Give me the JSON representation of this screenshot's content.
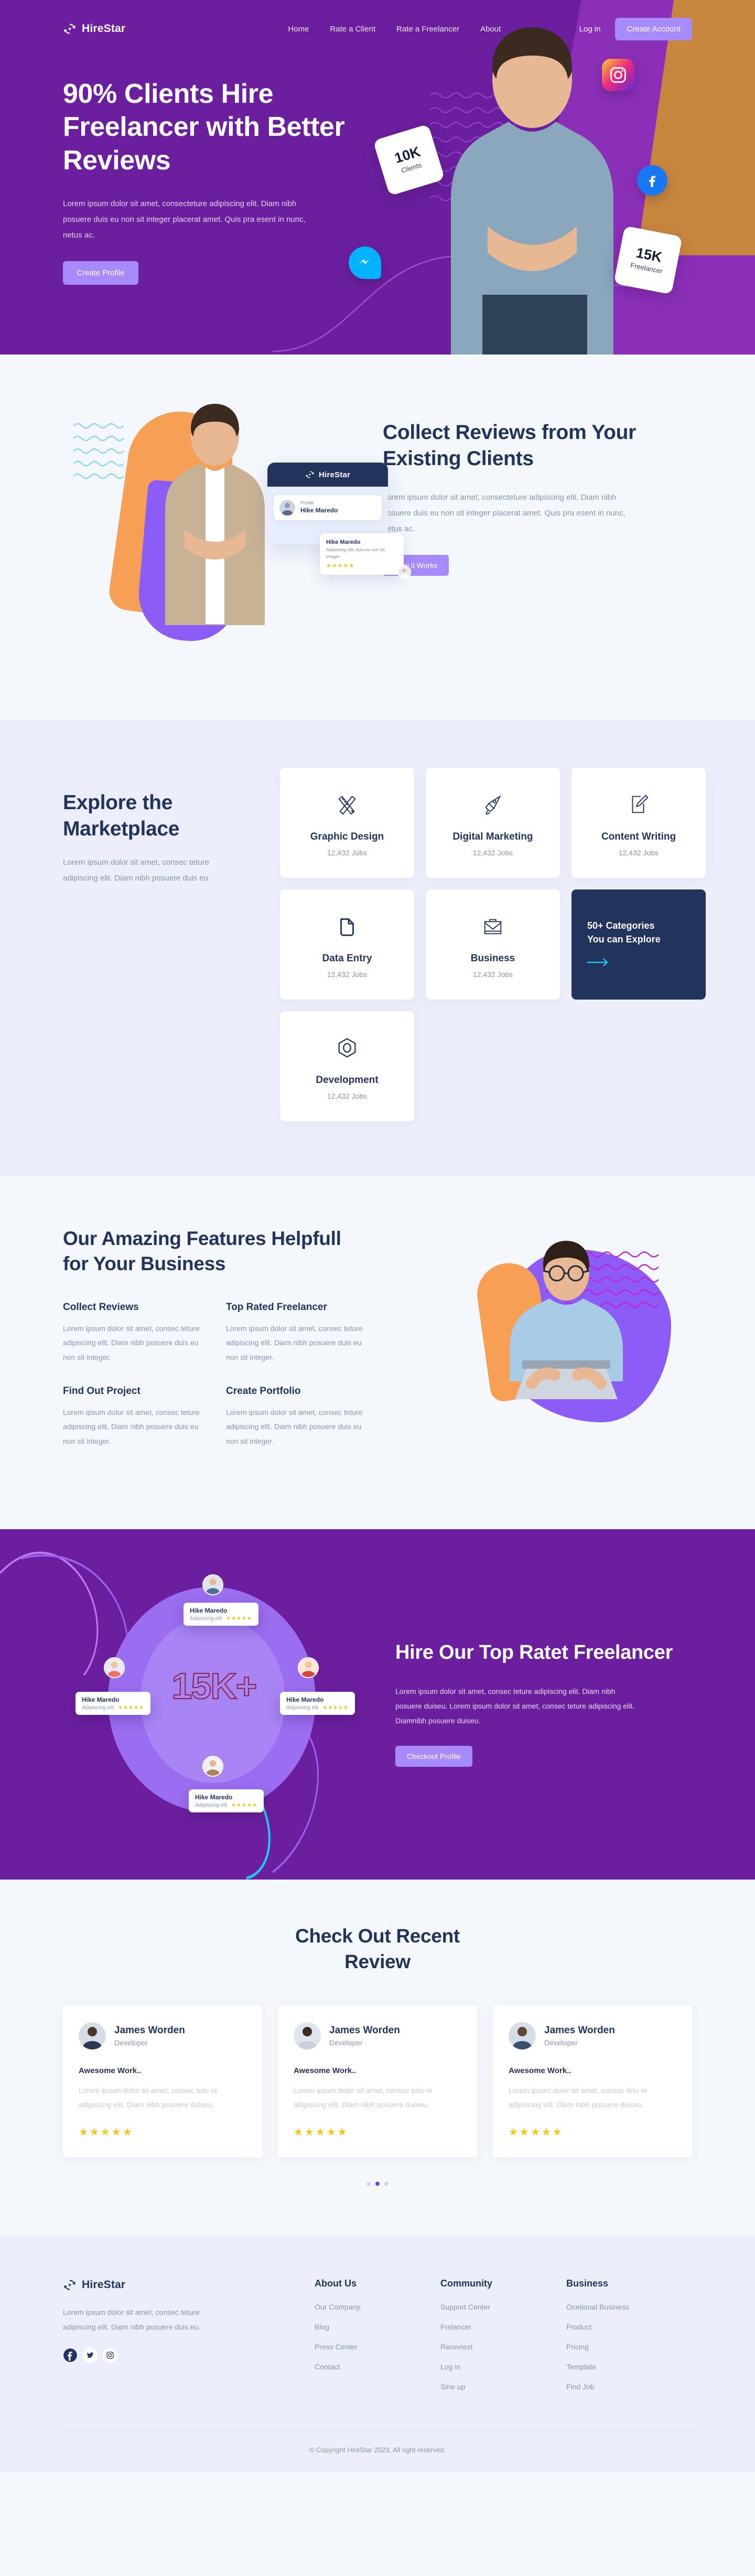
{
  "brand": {
    "name": "HireStar",
    "logo_icon": "refresh-star-icon"
  },
  "nav": {
    "links": [
      {
        "label": "Home"
      },
      {
        "label": "Rate a Client"
      },
      {
        "label": "Rate a Freelancer"
      },
      {
        "label": "About"
      }
    ],
    "login_label": "Log in",
    "create_account_label": "Create Account"
  },
  "hero": {
    "title": "90% Clients Hire Freelancer with Better Reviews",
    "subtitle": "Lorem ipsum dolor sit amet, consecteture adipiscing elit. Diam nibh posuere duis eu non sit integer placerat amet. Quis pra esent in nunc, netus ac.",
    "cta_label": "Create Profile",
    "badges": [
      {
        "number": "10K",
        "label": "Clients"
      },
      {
        "number": "15K",
        "label": "Freelancer"
      }
    ],
    "social_icons": [
      "instagram-icon",
      "facebook-icon",
      "messenger-icon"
    ]
  },
  "collect": {
    "title": "Collect Reviews from Your Existing Clients",
    "body": "Lorem ipsum dolor sit amet, consecteture adipiscing elit. Diam nibh posuere duis eu non sit integer placerat amet. Quis pra esent in nunc, netus ac.",
    "cta_label": "How it Works",
    "card": {
      "header_brand": "HireStar",
      "profile_label": "Profile",
      "profile_name": "Hike Maredo",
      "review_name": "Hike Maredo",
      "review_text": "Adipiscing elit, duis eu non sit integer",
      "review_stars": "★★★★★"
    }
  },
  "marketplace": {
    "title": "Explore the Marketplace",
    "body": "Lorem ipsum dolor sit amet, consec teture adipiscing elit. Diam nibh posuere  duis eu.",
    "cards": [
      {
        "title": "Graphic Design",
        "jobs": "12,432 Jobs",
        "icon": "ruler-pencil-icon"
      },
      {
        "title": "Digital Marketing",
        "jobs": "12,432 Jobs",
        "icon": "megaphone-icon"
      },
      {
        "title": "Content Writing",
        "jobs": "12,432 Jobs",
        "icon": "document-pencil-icon"
      },
      {
        "title": "Data Entry",
        "jobs": "12,432 Jobs",
        "icon": "file-icon"
      },
      {
        "title": "Business",
        "jobs": "12,432 Jobs",
        "icon": "briefcase-icon"
      },
      {
        "title": "Development",
        "jobs": "12,432 Jobs",
        "icon": "hexagon-icon"
      }
    ],
    "cta": {
      "line1": "50+ Categories",
      "line2": "You can Explore",
      "icon": "arrow-right-icon"
    }
  },
  "features": {
    "title": "Our Amazing Features Helpfull for Your Business",
    "items": [
      {
        "title": "Collect Reviews",
        "body": "Lorem ipsum dolor sit amet, consec teture adipiscing elit. Diam nibh posuere  duis eu non sit integer."
      },
      {
        "title": "Top Rated Freelancer",
        "body": "Lorem ipsum dolor sit amet, consec teture adipiscing elit. Diam nibh posuere  duis eu non sit integer."
      },
      {
        "title": "Find Out  Project",
        "body": "Lorem ipsum dolor sit amet, consec teture adipiscing elit. Diam nibh posuere  duis eu non sit integer."
      },
      {
        "title": "Create Portfolio",
        "body": "Lorem ipsum dolor sit amet, consec teture adipiscing elit. Diam nibh posuere  duis eu non sit integer."
      }
    ]
  },
  "toprated": {
    "title": "Hire Our Top Ratet Freelancer",
    "body": "Lorem ipsum dolor sit amet, consec teture adipiscing elit. Diam nibh posuere  duiseu. Lorem ipsum dolor sit amet, consec teture  adipiscing elit. Diamnibh posuere  duiseu.",
    "cta_label": "Checkout Profile",
    "counter": "15K+",
    "chips": [
      {
        "name": "Hike Maredo",
        "sub": "Adipiscing elit",
        "stars": "★★★★★"
      },
      {
        "name": "Hike Maredo",
        "sub": "Adipiscing elit",
        "stars": "★★★★★"
      },
      {
        "name": "Hike Maredo",
        "sub": "Adipiscing elit",
        "stars": "★★★★★"
      },
      {
        "name": "Hike Maredo",
        "sub": "Adipiscing elit",
        "stars": "★★★★★"
      }
    ]
  },
  "reviews": {
    "title": "Check Out Recent Review",
    "cards": [
      {
        "name": "James Worden",
        "role": "Developer",
        "headline": "Awesome Work..",
        "text": "Lorem ipsum dolor sit amet, consec tetu re adipiscing elit. Diam nibh posuere duiseu.",
        "stars": "★★★★★"
      },
      {
        "name": "James Worden",
        "role": "Developer",
        "headline": "Awesome Work..",
        "text": "Lorem ipsum dolor sit amet, consec tetu re adipiscing elit. Diam nibh posuere duiseu.",
        "stars": "★★★★★"
      },
      {
        "name": "James Worden",
        "role": "Developer",
        "headline": "Awesome Work..",
        "text": "Lorem ipsum dolor sit amet, consec tetu re adipiscing elit. Diam nibh posuere duiseu.",
        "stars": "★★★★★"
      }
    ],
    "dots": 3,
    "active_dot": 1
  },
  "footer": {
    "brand": "HireStar",
    "description": "Lorem ipsum dolor sit amet, consec teture adipiscing elit. Diam nibh posuere  duis eu.",
    "social": [
      "facebook-icon",
      "twitter-icon",
      "instagram-icon"
    ],
    "columns": [
      {
        "heading": "About Us",
        "links": [
          "Our Company",
          "Blog",
          "Press Center",
          "Contact"
        ]
      },
      {
        "heading": "Community",
        "links": [
          "Support Center",
          "Frelancer",
          "Receviest",
          "Log in",
          "Sine up"
        ]
      },
      {
        "heading": "Business",
        "links": [
          "Ocetional Business",
          "Product",
          "Pricing",
          "Template",
          "Find Job"
        ]
      }
    ],
    "copyright": "© Copyright HireStar 2023. All right reserved."
  },
  "colors": {
    "purple": "#6b1f9e",
    "lilac": "#a78bfa",
    "navy": "#22335c",
    "muted": "#8a94ad",
    "star": "#f5c518",
    "page_bg": "#f4f7fc",
    "alt_bg": "#eceefb"
  }
}
